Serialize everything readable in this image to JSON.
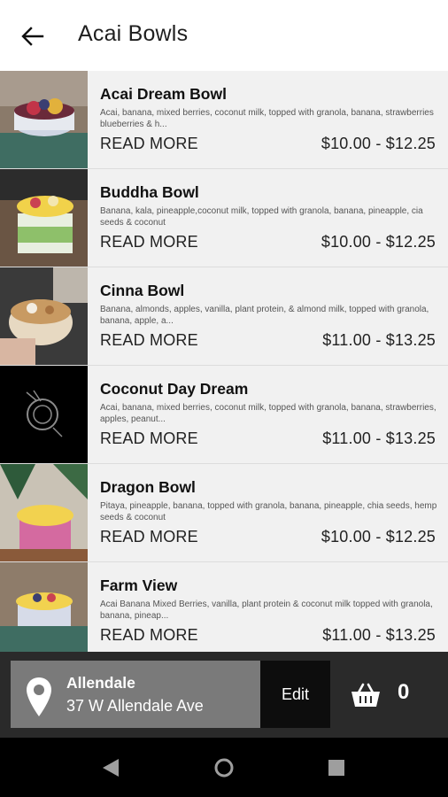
{
  "header": {
    "title": "Acai Bowls",
    "back_icon": "arrow-left-icon"
  },
  "items": [
    {
      "name": "Acai Dream Bowl",
      "description": "Acai, banana, mixed berries, coconut milk, topped with granola, banana, strawberries blueberries & h...",
      "read_more": "READ MORE",
      "price": "$10.00 - $12.25",
      "image": "acai-dream-bowl-photo"
    },
    {
      "name": "Buddha Bowl",
      "description": "Banana, kala, pineapple,coconut milk, topped with granola, banana, pineapple, cia seeds & coconut",
      "read_more": "READ MORE",
      "price": "$10.00 - $12.25",
      "image": "buddha-bowl-photo"
    },
    {
      "name": "Cinna Bowl",
      "description": "Banana, almonds, apples, vanilla, plant protein, & almond milk, topped with granola, banana, apple, a...",
      "read_more": "READ MORE",
      "price": "$11.00 - $13.25",
      "image": "cinna-bowl-photo"
    },
    {
      "name": "Coconut Day Dream",
      "description": "Acai, banana, mixed berries, coconut milk, topped with granola, banana, strawberries, apples, peanut...",
      "read_more": "READ MORE",
      "price": "$11.00 - $13.25",
      "image": "coconut-logo-placeholder"
    },
    {
      "name": "Dragon Bowl",
      "description": "Pitaya, pineapple, banana, topped with granola, banana, pineapple, chia seeds, hemp seeds & coconut",
      "read_more": "READ MORE",
      "price": "$10.00 - $12.25",
      "image": "dragon-bowl-photo"
    },
    {
      "name": "Farm View",
      "description": "Acai Banana Mixed Berries, vanilla, plant protein & coconut milk topped with granola, banana, pineap...",
      "read_more": "READ MORE",
      "price": "$11.00 - $13.25",
      "image": "farm-view-photo"
    }
  ],
  "location": {
    "name": "Allendale",
    "address": "37 W Allendale Ave",
    "edit_label": "Edit",
    "pin_icon": "location-pin-icon"
  },
  "cart": {
    "count": "0",
    "icon": "basket-icon"
  },
  "system_nav": {
    "back": "nav-back-icon",
    "home": "nav-home-icon",
    "recents": "nav-recents-icon"
  },
  "colors": {
    "item_bg": "#f1f1f1",
    "bottom_bar": "#2a2a2a",
    "location_card": "#7a7a7a",
    "edit_button": "#0d0d0d"
  }
}
